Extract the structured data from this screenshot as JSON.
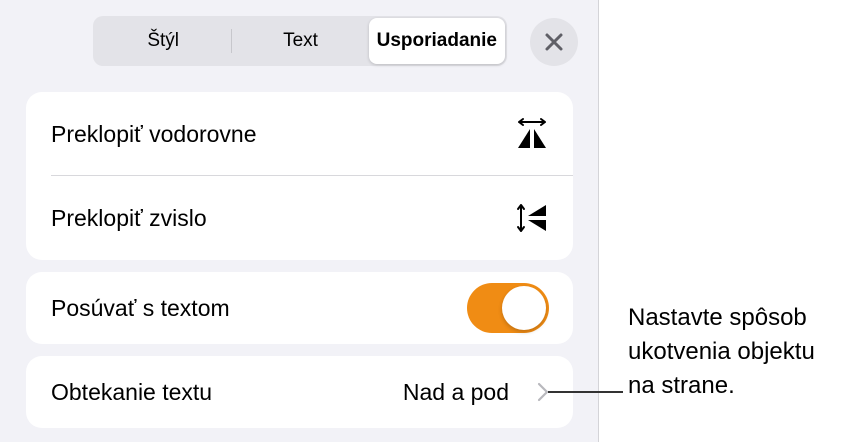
{
  "tabs": [
    {
      "label": "Štýl",
      "active": false
    },
    {
      "label": "Text",
      "active": false
    },
    {
      "label": "Usporiadanie",
      "active": true
    }
  ],
  "close_icon": "close-icon",
  "flip_group": {
    "horizontal_label": "Preklopiť vodorovne",
    "horizontal_icon": "flip-horizontal-icon",
    "vertical_label": "Preklopiť zvislo",
    "vertical_icon": "flip-vertical-icon"
  },
  "move_with_text": {
    "label": "Posúvať s textom",
    "enabled": true,
    "color": "#F08C14"
  },
  "text_wrap": {
    "label": "Obtekanie textu",
    "value": "Nad a pod",
    "icon": "chevron-right-icon"
  },
  "callout": {
    "line1": "Nastavte spôsob",
    "line2": "ukotvenia objektu",
    "line3": "na strane."
  }
}
